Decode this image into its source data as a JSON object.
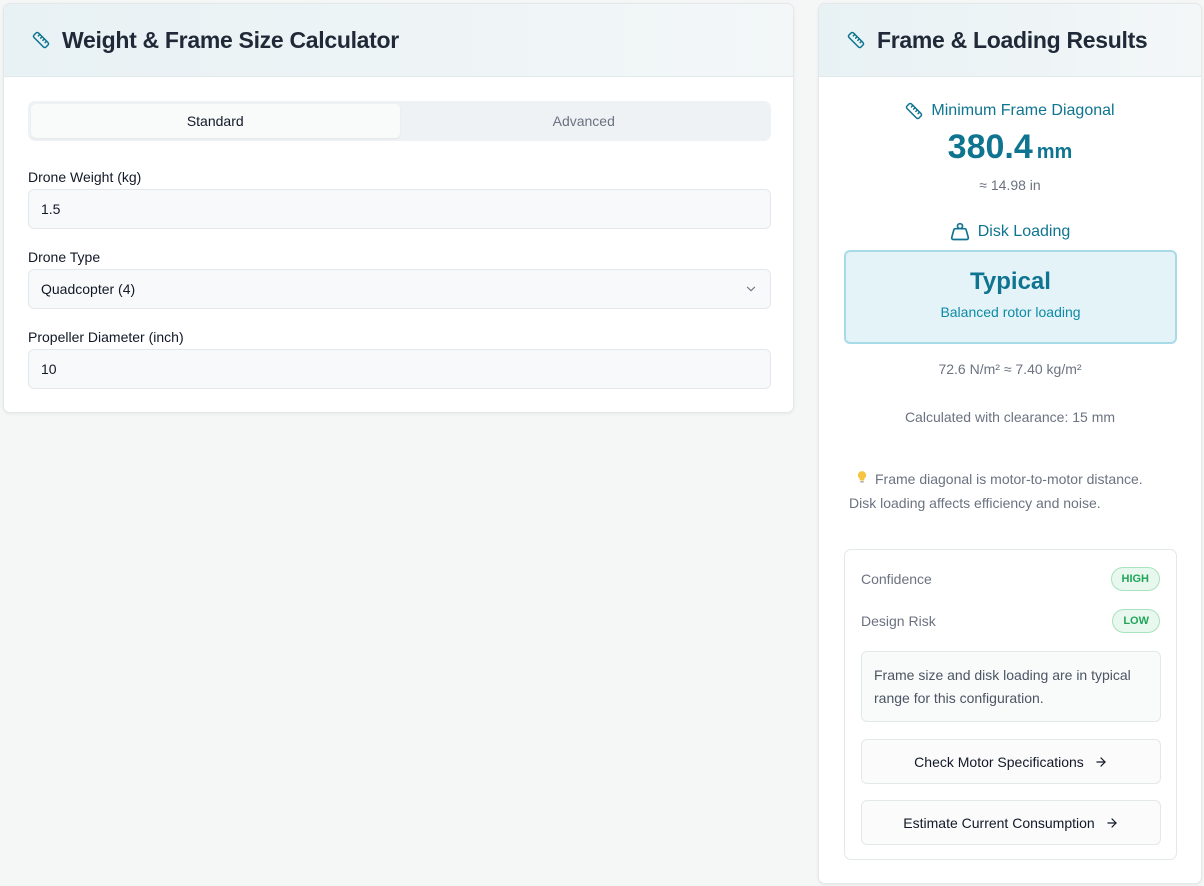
{
  "calculator": {
    "title": "Weight & Frame Size Calculator",
    "icon": "ruler-icon",
    "tabs": [
      {
        "label": "Standard",
        "active": true
      },
      {
        "label": "Advanced",
        "active": false
      }
    ],
    "fields": {
      "weight": {
        "label": "Drone Weight (kg)",
        "value": "1.5"
      },
      "type": {
        "label": "Drone Type",
        "value": "Quadcopter (4)"
      },
      "propeller": {
        "label": "Propeller Diameter (inch)",
        "value": "10"
      }
    }
  },
  "results": {
    "title": "Frame & Loading Results",
    "icon": "ruler-icon",
    "frame": {
      "heading": "Minimum Frame Diagonal",
      "value": "380.4",
      "unit": "mm",
      "imperial": "≈ 14.98 in"
    },
    "disk": {
      "heading": "Disk Loading",
      "icon": "weight-icon",
      "status": "Typical",
      "status_desc": "Balanced rotor loading",
      "values": "72.6 N/m² ≈ 7.40 kg/m²"
    },
    "clearance": "Calculated with clearance: 15 mm",
    "tip": {
      "icon": "lightbulb-icon",
      "line1": "Frame diagonal is motor-to-motor distance.",
      "line2": "Disk loading affects efficiency and noise."
    },
    "assessment": {
      "confidence_label": "Confidence",
      "confidence_value": "HIGH",
      "risk_label": "Design Risk",
      "risk_value": "LOW",
      "note": "Frame size and disk loading are in typical range for this configuration.",
      "buttons": [
        {
          "label": "Check Motor Specifications"
        },
        {
          "label": "Estimate Current Consumption"
        }
      ]
    }
  },
  "colors": {
    "accent": "#0e7490",
    "success": "#22a55a",
    "background": "#f5f7f7"
  }
}
